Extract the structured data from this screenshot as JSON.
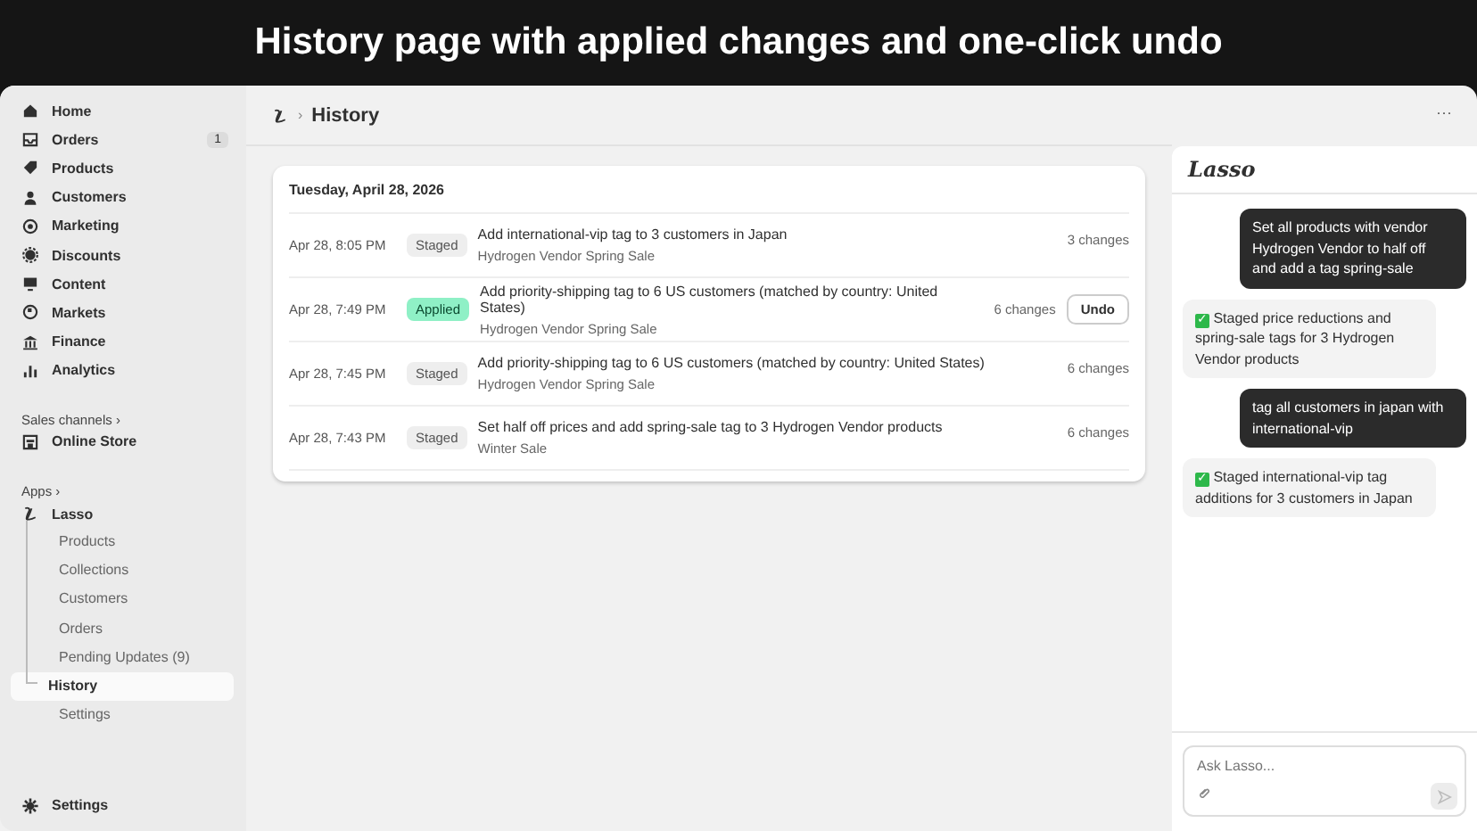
{
  "banner": {
    "title": "History page with applied changes and one-click undo"
  },
  "sidebar": {
    "items": [
      {
        "label": "Home"
      },
      {
        "label": "Orders",
        "count": "1"
      },
      {
        "label": "Products"
      },
      {
        "label": "Customers"
      },
      {
        "label": "Marketing"
      },
      {
        "label": "Discounts"
      },
      {
        "label": "Content"
      },
      {
        "label": "Markets"
      },
      {
        "label": "Finance"
      },
      {
        "label": "Analytics"
      }
    ],
    "sales_channels": {
      "label": "Sales channels",
      "caret": "›",
      "items": [
        {
          "label": "Online Store"
        }
      ]
    },
    "apps": {
      "label": "Apps",
      "caret": "›",
      "app": {
        "label": "Lasso",
        "children": [
          {
            "label": "Products",
            "selected": false
          },
          {
            "label": "Collections",
            "selected": false
          },
          {
            "label": "Customers",
            "selected": false
          },
          {
            "label": "Orders",
            "selected": false
          },
          {
            "label": "Pending Updates (9)",
            "selected": false
          },
          {
            "label": "History",
            "selected": true
          },
          {
            "label": "Settings",
            "selected": false
          }
        ]
      }
    },
    "settings": {
      "label": "Settings"
    }
  },
  "header": {
    "separator": "›",
    "title": "History",
    "more": "···"
  },
  "history": {
    "date": "Tuesday, April 28, 2026",
    "rows": [
      {
        "time": "Apr 28, 8:05 PM",
        "status": "Staged",
        "kind": "staged",
        "title": "Add international-vip tag to 3 customers in Japan",
        "subtitle": "Hydrogen Vendor Spring Sale",
        "changes": "3 changes"
      },
      {
        "time": "Apr 28, 7:49 PM",
        "status": "Applied",
        "kind": "applied",
        "title": "Add priority-shipping tag to 6 US customers (matched by country: United States)",
        "subtitle": "Hydrogen Vendor Spring Sale",
        "changes": "6 changes",
        "action": "Undo"
      },
      {
        "time": "Apr 28, 7:45 PM",
        "status": "Staged",
        "kind": "staged",
        "title": "Add priority-shipping tag to 6 US customers (matched by country: United States)",
        "subtitle": "Hydrogen Vendor Spring Sale",
        "changes": "6 changes"
      },
      {
        "time": "Apr 28, 7:43 PM",
        "status": "Staged",
        "kind": "staged",
        "title": "Set half off prices and add spring-sale tag to 3 Hydrogen Vendor products",
        "subtitle": "Winter Sale",
        "changes": "6 changes"
      }
    ]
  },
  "chat": {
    "logo": "Lasso",
    "messages": [
      {
        "kind": "user",
        "text": "Set all products with vendor Hydrogen Vendor to  half  off and add a tag spring-sale"
      },
      {
        "kind": "assistant",
        "check": "✓",
        "text": "Staged price reductions and spring-sale tags for 3 Hydrogen Vendor products"
      },
      {
        "kind": "user",
        "text": "tag all customers in japan with international-vip"
      },
      {
        "kind": "assistant",
        "check": "✓",
        "text": "Staged international-vip tag additions for 3 customers in Japan"
      }
    ],
    "input": {
      "placeholder": "Ask Lasso..."
    }
  }
}
